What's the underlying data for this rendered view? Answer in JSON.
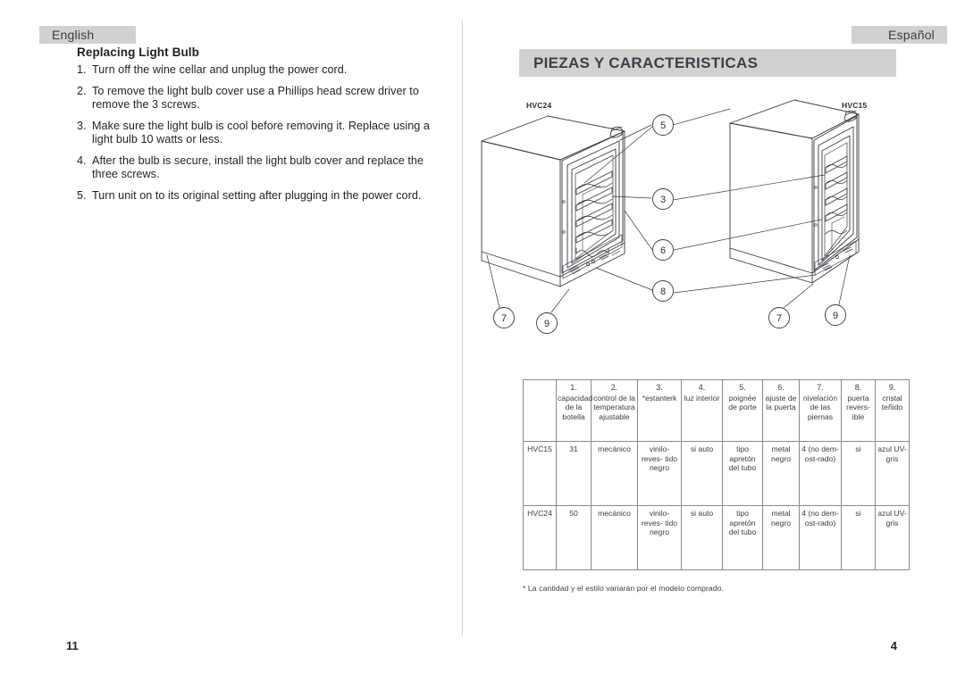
{
  "tabs": {
    "left_label": "English",
    "right_label": "Español"
  },
  "english": {
    "heading": "Replacing Light Bulb",
    "steps": [
      {
        "num": "1.",
        "text": "Turn off the wine cellar and unplug the power cord."
      },
      {
        "num": "2.",
        "text": "To remove the light bulb cover use a Phillips head screw driver to remove the 3 screws."
      },
      {
        "num": "3.",
        "text": "Make sure the light bulb is cool before removing it. Replace using a light bulb 10 watts or less."
      },
      {
        "num": "4.",
        "text": "After the bulb is secure, install the light bulb cover and replace the three screws."
      },
      {
        "num": "5.",
        "text": "Turn unit on to its original setting after plugging in the power cord."
      }
    ]
  },
  "spanish": {
    "banner_title": "PIEZAS Y CARACTERISTICAS",
    "diagram": {
      "model_left": "HVC24",
      "model_right": "HVC15",
      "callouts": [
        "5",
        "3",
        "6",
        "8",
        "7",
        "9",
        "7",
        "9"
      ]
    },
    "table": {
      "headers": [
        {
          "num": "",
          "label": ""
        },
        {
          "num": "1.",
          "label": "capacidad de la botella"
        },
        {
          "num": "2.",
          "label": "control de la temperatura ajustable"
        },
        {
          "num": "3.",
          "label": "*estanterk"
        },
        {
          "num": "4.",
          "label": "luz interior"
        },
        {
          "num": "5.",
          "label": "poignée de porte"
        },
        {
          "num": "6.",
          "label": "ajuste de la puerta"
        },
        {
          "num": "7.",
          "label": "nivelación de las piernas"
        },
        {
          "num": "8.",
          "label": "puerta revers- ible"
        },
        {
          "num": "9.",
          "label": "cristal teñido"
        }
      ],
      "rows": [
        {
          "model": "HVC15",
          "capacidad": "31",
          "control": "mecánico",
          "estanteria": "vinilo-reves- tido negro",
          "luz": "si auto",
          "poignee": "tipo apretón del tubo",
          "ajuste": "metal negro",
          "nivelacion": "4 (no dem- ost-rado)",
          "reversible": "si",
          "cristal": "azul UV-gris"
        },
        {
          "model": "HVC24",
          "capacidad": "50",
          "control": "mecánico",
          "estanteria": "vinilo-reves- tido negro",
          "luz": "si auto",
          "poignee": "tipo apretón del tubo",
          "ajuste": "metal negro",
          "nivelacion": "4 (no dem- ost-rado)",
          "reversible": "si",
          "cristal": "azul UV-gris"
        }
      ],
      "note": "* La cantidad y el estilo variarán por el modelo comprado."
    }
  },
  "footer": {
    "page_left": "11",
    "page_right": "4"
  },
  "colors": {
    "tab_bg": "#d3d1cf",
    "banner_bg": "#d3d1cf",
    "banner_text": "#3e3e4a",
    "table_border": "#8d8795",
    "body_text": "#231f20"
  }
}
